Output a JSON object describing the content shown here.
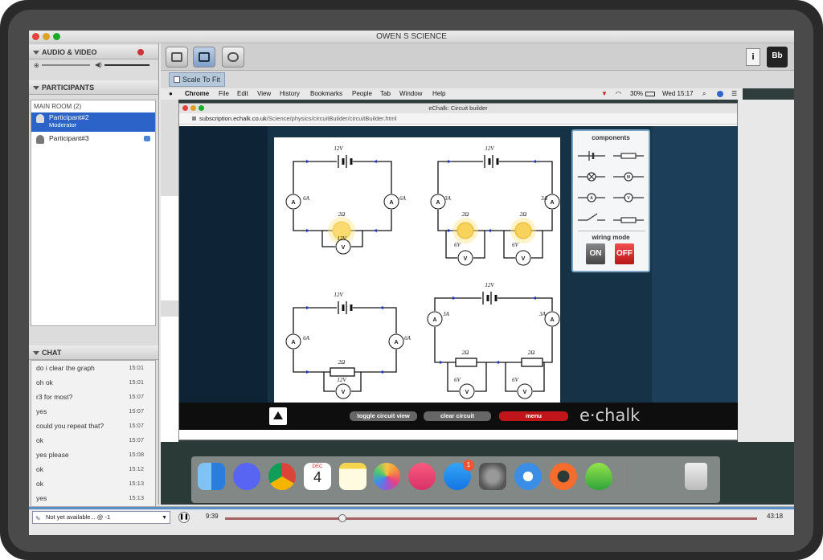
{
  "app": {
    "title": "OWEN S SCIENCE"
  },
  "side": {
    "audio_video": "AUDIO & VIDEO",
    "participants_header": "PARTICIPANTS",
    "main_room": "MAIN ROOM (2)",
    "participants": [
      {
        "name": "Participant#2",
        "role": "Moderator"
      },
      {
        "name": "Participant#3",
        "role": ""
      }
    ],
    "chat_header": "CHAT",
    "chat": [
      {
        "text": "do i clear the graph",
        "time": "15:01"
      },
      {
        "text": "oh ok",
        "time": "15:01"
      },
      {
        "text": "r3 for most?",
        "time": "15:07"
      },
      {
        "text": "yes",
        "time": "15:07"
      },
      {
        "text": "could you repeat that?",
        "time": "15:07"
      },
      {
        "text": "ok",
        "time": "15:07"
      },
      {
        "text": "yes please",
        "time": "15:08"
      },
      {
        "text": "ok",
        "time": "15:12"
      },
      {
        "text": "ok",
        "time": "15:13"
      },
      {
        "text": "yes",
        "time": "15:13"
      }
    ]
  },
  "toolbar": {
    "scale_to_fit": "Scale To Fit"
  },
  "mac_menu": {
    "app": "Chrome",
    "items": [
      "File",
      "Edit",
      "View",
      "History",
      "Bookmarks",
      "People",
      "Tab",
      "Window",
      "Help"
    ],
    "battery": "30%",
    "clock": "Wed 15:17"
  },
  "browser": {
    "title": "eChalk: Circuit builder",
    "url_host": "subscription.echalk.co.uk",
    "url_path": "/Science/physics/circuitBuilder/circuitBuilder.html"
  },
  "circuits": {
    "v12": "12V",
    "r2": "2Ω",
    "v6": "6V",
    "i6": "6A",
    "i3": "3A",
    "ammeter": "A",
    "voltmeter": "V"
  },
  "panel": {
    "components": "components",
    "wiring_mode": "wiring mode",
    "on": "ON",
    "off": "OFF",
    "m": "M",
    "a": "A",
    "v": "V"
  },
  "echalk": {
    "toggle": "toggle circuit view",
    "clear": "clear circuit",
    "menu": "menu",
    "logo": "e·chalk"
  },
  "dock": {
    "calendar_month": "DEC",
    "calendar_day": "4",
    "badge": "1",
    "icons": [
      "finder-icon",
      "discord-icon",
      "chrome-icon",
      "calendar-icon",
      "notes-icon",
      "photos-icon",
      "music-icon",
      "appstore-icon",
      "settings-icon",
      "safari-icon",
      "origin-icon",
      "sims-icon",
      "trash-icon"
    ]
  },
  "playback": {
    "status": "Not yet available... @ -1",
    "current": "9:39",
    "total": "43:18",
    "progress": 0.22
  }
}
